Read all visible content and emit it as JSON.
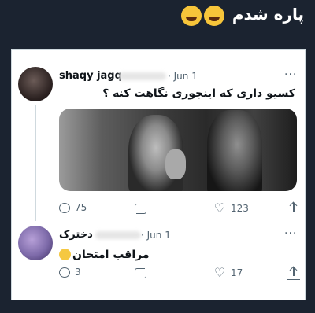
{
  "caption": {
    "text": "پاره شدم"
  },
  "tweets": [
    {
      "author": "shaqy jagq",
      "date": "· Jun 1",
      "more": "···",
      "text": "کسیو داری که اینجوری نگاهت کنه ؟",
      "replies": "75",
      "retweets": "",
      "likes": "123"
    },
    {
      "author": "دخترک",
      "date": "· Jun 1",
      "more": "···",
      "text": "مراقب امتحان",
      "replies": "3",
      "retweets": "",
      "likes": "17"
    }
  ],
  "icons": {
    "caption_emoji": "laughing-tears-emoji",
    "reply": "reply-icon",
    "retweet": "retweet-icon",
    "like": "heart-icon",
    "share": "share-icon",
    "text_emoji": "smile-emoji"
  },
  "colors": {
    "background": "#1b2330",
    "card": "#ffffff",
    "muted": "#536471"
  }
}
